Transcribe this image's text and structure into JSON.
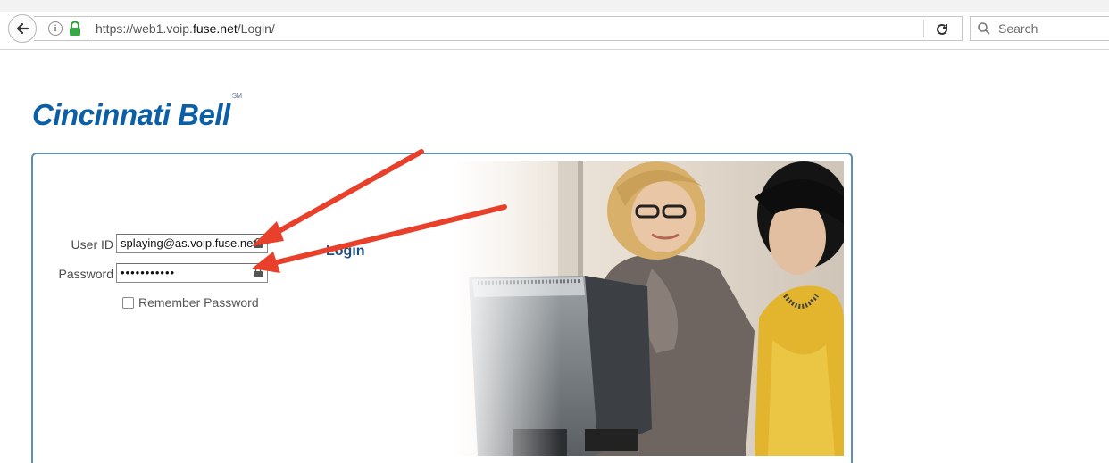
{
  "browser": {
    "url_prefix": "https://web1.voip.",
    "url_domain": "fuse.net",
    "url_suffix": "/Login/",
    "search_placeholder": "Search"
  },
  "page": {
    "logo_text": "Cincinnati Bell",
    "logo_mark": "SM",
    "login": {
      "user_label": "User ID",
      "user_value": "splaying@as.voip.fuse.net",
      "password_label": "Password",
      "password_value": "•••••••••••",
      "remember_label": "Remember Password",
      "remember_checked": false,
      "login_label": "Login"
    }
  },
  "colors": {
    "brand_blue": "#0b5fa6",
    "panel_border": "#5e8fae",
    "annotation_arrow": "#e8402a"
  },
  "icons": [
    "back-arrow-icon",
    "info-icon",
    "lock-icon",
    "reload-icon",
    "search-icon",
    "field-autofill-icon"
  ]
}
